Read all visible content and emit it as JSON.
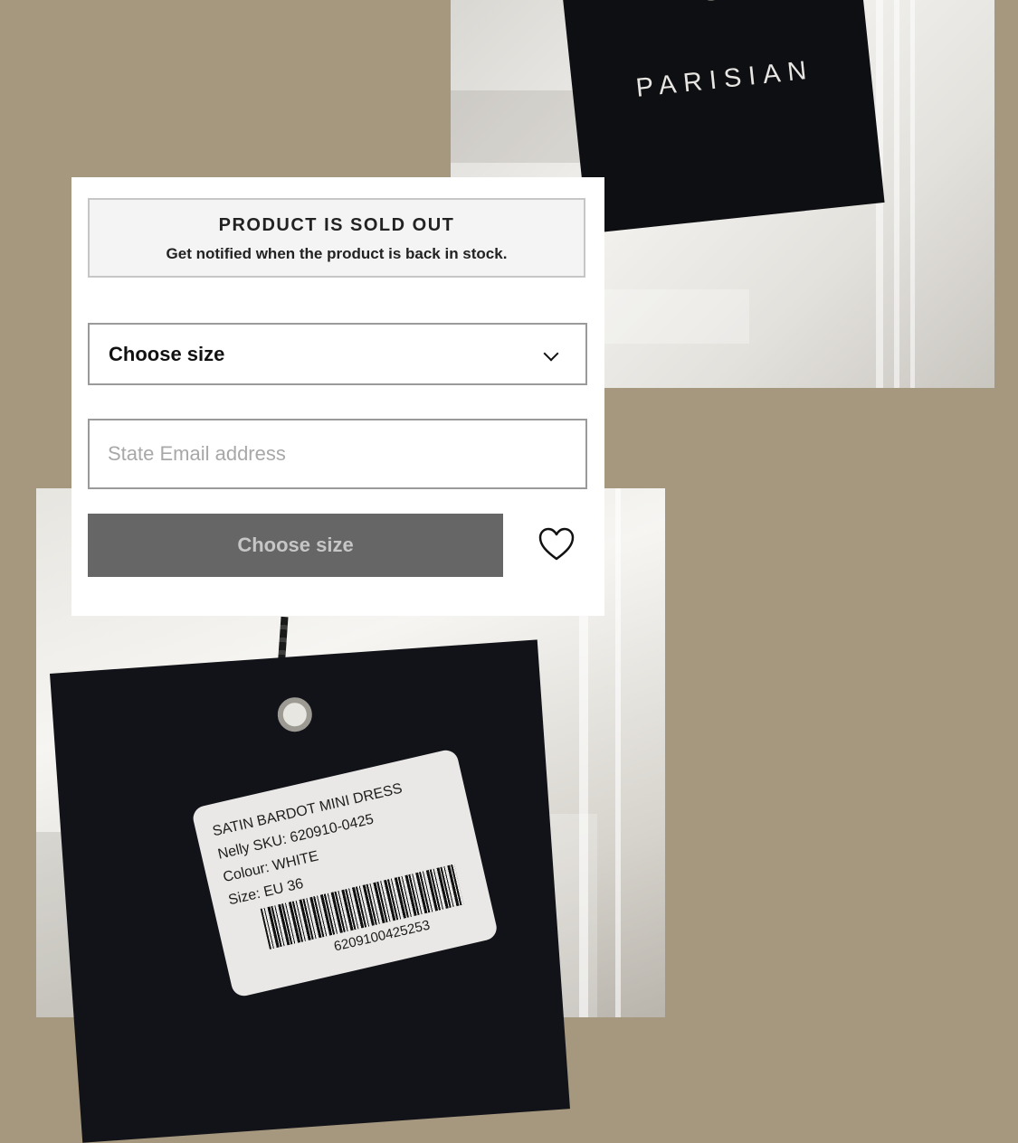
{
  "brand_tag": {
    "text": "PARISIAN"
  },
  "product_label": {
    "name": "SATIN BARDOT MINI DRESS",
    "sku": "Nelly SKU: 620910-0425",
    "colour": "Colour: WHITE",
    "size": "Size: EU 36",
    "barcode_number": "6209100425253"
  },
  "notify_panel": {
    "notice_title": "PRODUCT IS SOLD OUT",
    "notice_subtitle": "Get notified when the product is back in stock.",
    "size_select_label": "Choose size",
    "email_placeholder": "State Email address",
    "submit_label": "Choose size"
  },
  "icons": {
    "dropdown": "chevron-down-icon",
    "favorite": "heart-icon"
  },
  "colors": {
    "button_bg": "#666666",
    "button_text": "#c6c6c6",
    "notice_bg": "#f4f4f4"
  }
}
